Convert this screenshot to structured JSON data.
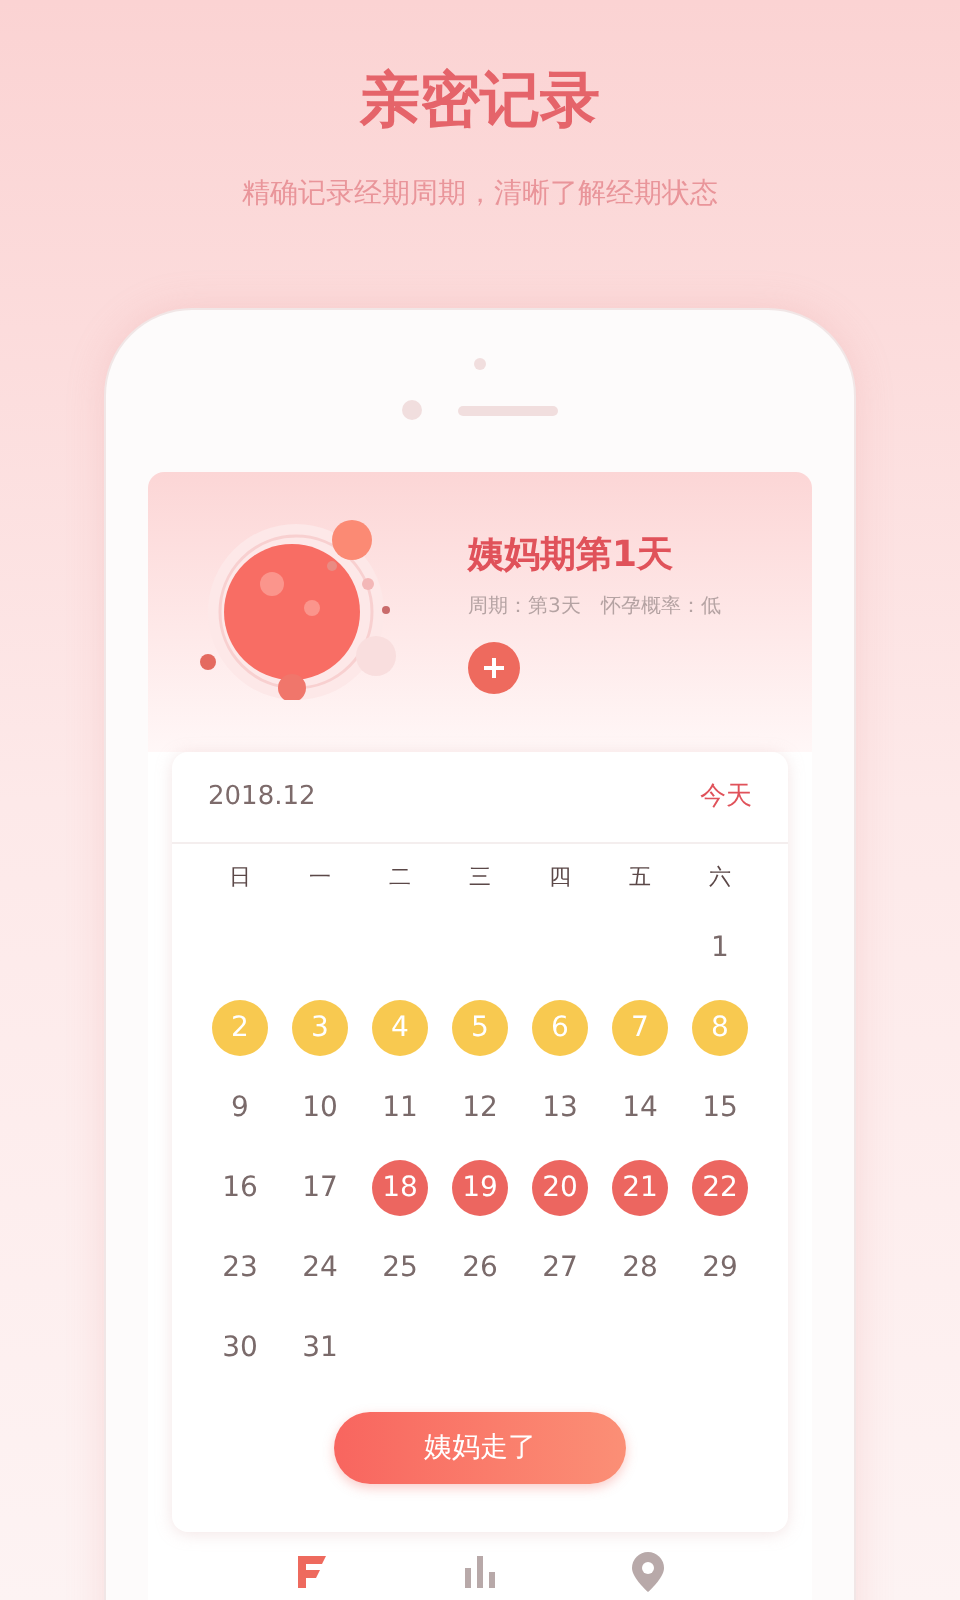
{
  "headline": "亲密记录",
  "subheadline": "精确记录经期周期，清晰了解经期状态",
  "status": {
    "title": "姨妈期第1天",
    "cycle": "周期：第3天",
    "pregnancy_chance": "怀孕概率：低"
  },
  "calendar": {
    "month": "2018.12",
    "today_link": "今天",
    "weekdays": [
      "日",
      "一",
      "二",
      "三",
      "四",
      "五",
      "六"
    ],
    "weeks": [
      [
        {
          "kind": "blank"
        },
        {
          "kind": "blank"
        },
        {
          "kind": "blank"
        },
        {
          "kind": "blank"
        },
        {
          "kind": "blank"
        },
        {
          "kind": "blank"
        },
        {
          "kind": "plain",
          "day": "1"
        }
      ],
      [
        {
          "kind": "predicted",
          "day": "2"
        },
        {
          "kind": "predicted",
          "day": "3"
        },
        {
          "kind": "predicted",
          "day": "4"
        },
        {
          "kind": "predicted",
          "day": "5"
        },
        {
          "kind": "predicted",
          "day": "6"
        },
        {
          "kind": "predicted",
          "day": "7"
        },
        {
          "kind": "predicted",
          "day": "8"
        }
      ],
      [
        {
          "kind": "plain",
          "day": "9"
        },
        {
          "kind": "plain",
          "day": "10"
        },
        {
          "kind": "plain",
          "day": "11"
        },
        {
          "kind": "plain",
          "day": "12"
        },
        {
          "kind": "plain",
          "day": "13"
        },
        {
          "kind": "plain",
          "day": "14"
        },
        {
          "kind": "plain",
          "day": "15"
        }
      ],
      [
        {
          "kind": "plain",
          "day": "16"
        },
        {
          "kind": "plain",
          "day": "17"
        },
        {
          "kind": "period",
          "day": "18"
        },
        {
          "kind": "period",
          "day": "19"
        },
        {
          "kind": "period",
          "day": "20"
        },
        {
          "kind": "period",
          "day": "21"
        },
        {
          "kind": "period",
          "day": "22"
        }
      ],
      [
        {
          "kind": "plain",
          "day": "23"
        },
        {
          "kind": "plain",
          "day": "24"
        },
        {
          "kind": "plain",
          "day": "25"
        },
        {
          "kind": "plain",
          "day": "26"
        },
        {
          "kind": "plain",
          "day": "27"
        },
        {
          "kind": "plain",
          "day": "28"
        },
        {
          "kind": "plain",
          "day": "29"
        }
      ],
      [
        {
          "kind": "plain",
          "day": "30"
        },
        {
          "kind": "plain",
          "day": "31"
        }
      ]
    ]
  },
  "action_button": "姨妈走了",
  "tabs": [
    {
      "selected": true
    },
    {
      "selected": false
    },
    {
      "selected": false
    }
  ]
}
